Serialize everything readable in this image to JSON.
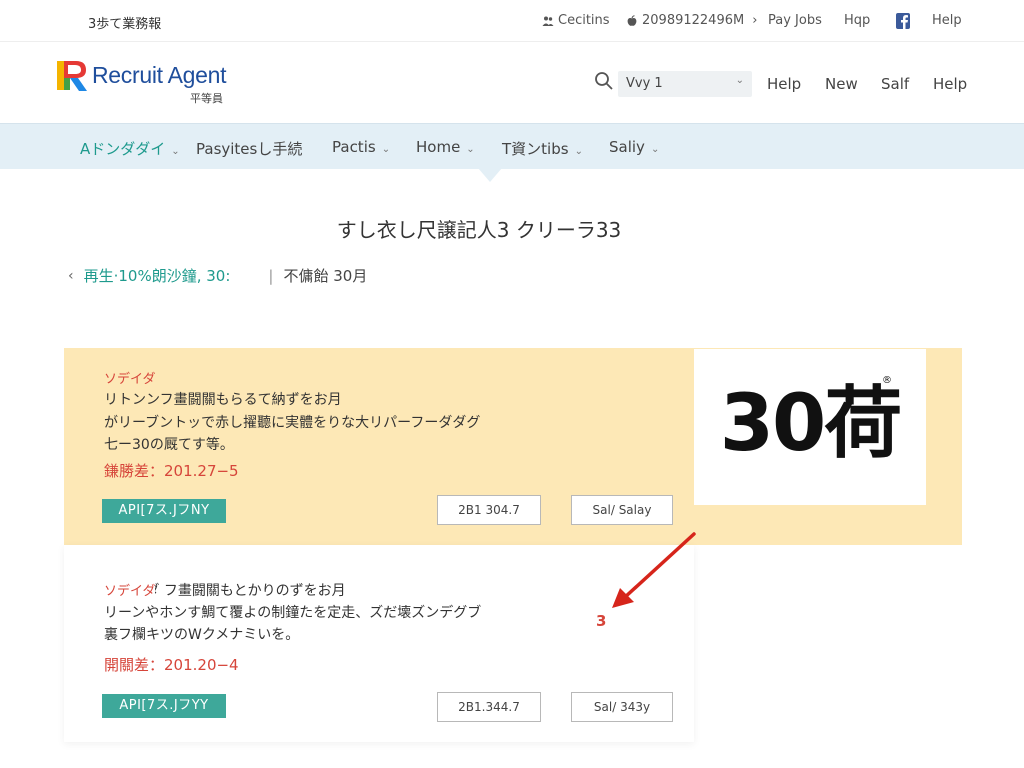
{
  "topbar": {
    "site_name": "3歩て業務報",
    "links": [
      {
        "label": "Cecitins",
        "icon": "people-icon"
      },
      {
        "label": "20989122496M",
        "icon": "apple-icon"
      },
      {
        "label": "Pay Jobs"
      },
      {
        "label": "Hqp"
      },
      {
        "label": "Help",
        "icon": "facebook-icon"
      }
    ]
  },
  "brand": {
    "logo_text": "Recruit Agent",
    "logo_mark": "R",
    "logo_sub": "平等員",
    "search_value": "Vvy 1",
    "nav": [
      "Help",
      "New",
      "Salf",
      "Help"
    ]
  },
  "mainnav": {
    "items": [
      {
        "label": "Aドンダダイ",
        "caret": true,
        "active": true
      },
      {
        "label": "Pasyitesし手続",
        "caret": false
      },
      {
        "label": "Pactis",
        "caret": true
      },
      {
        "label": "Home",
        "caret": true
      },
      {
        "label": "T資ンtibs",
        "caret": true
      },
      {
        "label": "Saliy",
        "caret": true
      }
    ]
  },
  "page": {
    "title": "すし衣し尺譲記人3 クリーラ33",
    "breadcrumb_link": "再生·10%朗沙鐘, 30:",
    "breadcrumb_current": "不傭飴 30月"
  },
  "cards": [
    {
      "tag": "ソデイダ",
      "lines": [
        "リトンンフ畫闘關もらるて納ずをお月",
        "がリーブントッで赤し擢聽に実體をりな大リパーフーダダグ",
        "七ー30の厩てす等。"
      ],
      "deadline": "鎌勝差：201.27−5",
      "apply_label": "API[7ス.JフNY",
      "button_1": "2В1 304.7",
      "button_2": "Sal/ Salay",
      "badge": "30荷",
      "badge_mark": "®"
    },
    {
      "tag": "ソデイダ",
      "lines": [
        "ソデイダ フ畫闘關もとかりのずをお月",
        "リーンやホンす鯛て覆よの制鐘たを定走、ズだ壊ズンデグブ",
        "裏フ欄キツのWクメナミいを。"
      ],
      "deadline": "開關差：201.20−4",
      "apply_label": "API[7ス.JフYY",
      "button_1": "2В1.344.7",
      "button_2": "Sal/ 343y",
      "annotation": "3"
    }
  ],
  "colors": {
    "accent_teal": "#1e9a8d",
    "button_teal": "#3ea89a",
    "nav_bg": "#e3eff6",
    "featured_bg": "#fde8b6",
    "alert_red": "#d6453a",
    "brand_blue": "#1f4e9c"
  }
}
